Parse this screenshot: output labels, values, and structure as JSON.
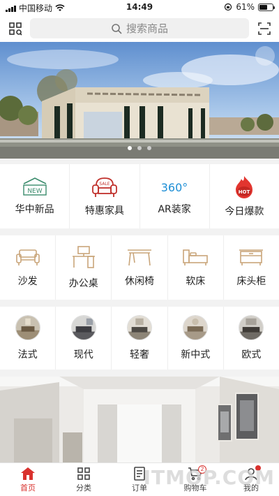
{
  "status_bar": {
    "carrier": "中国移动",
    "time": "14:49",
    "battery": "61%",
    "battery_level": 0.61
  },
  "header": {
    "scan_icon": "scan-grid-icon",
    "search_placeholder": "搜索商品",
    "search_icon": "search-icon",
    "qr_icon": "qr-scan-icon"
  },
  "banner": {
    "slides": 3,
    "active_slide": 1
  },
  "promo_row": [
    {
      "label": "华中新品",
      "icon": "new-badge-icon"
    },
    {
      "label": "特惠家具",
      "icon": "sale-sofa-icon"
    },
    {
      "label": "AR装家",
      "icon": "360-icon",
      "icon_text": "360°"
    },
    {
      "label": "今日爆款",
      "icon": "hot-flame-icon",
      "icon_text": "HOT"
    }
  ],
  "category_row": [
    {
      "label": "沙发",
      "icon": "sofa-icon"
    },
    {
      "label": "办公桌",
      "icon": "office-desk-icon"
    },
    {
      "label": "休闲椅",
      "icon": "leisure-chair-icon"
    },
    {
      "label": "软床",
      "icon": "bed-icon"
    },
    {
      "label": "床头柜",
      "icon": "nightstand-icon"
    }
  ],
  "style_row": [
    {
      "label": "法式"
    },
    {
      "label": "现代"
    },
    {
      "label": "轻奢"
    },
    {
      "label": "新中式"
    },
    {
      "label": "欧式"
    }
  ],
  "tabs": [
    {
      "label": "首页",
      "icon": "home-icon",
      "active": true
    },
    {
      "label": "分类",
      "icon": "category-icon"
    },
    {
      "label": "订单",
      "icon": "order-icon"
    },
    {
      "label": "购物车",
      "icon": "cart-icon",
      "badge": "2"
    },
    {
      "label": "我的",
      "icon": "user-icon"
    }
  ],
  "watermark": "ITMOP.COM",
  "colors": {
    "accent": "#d9322e",
    "category_icon": "#c9a57a"
  }
}
